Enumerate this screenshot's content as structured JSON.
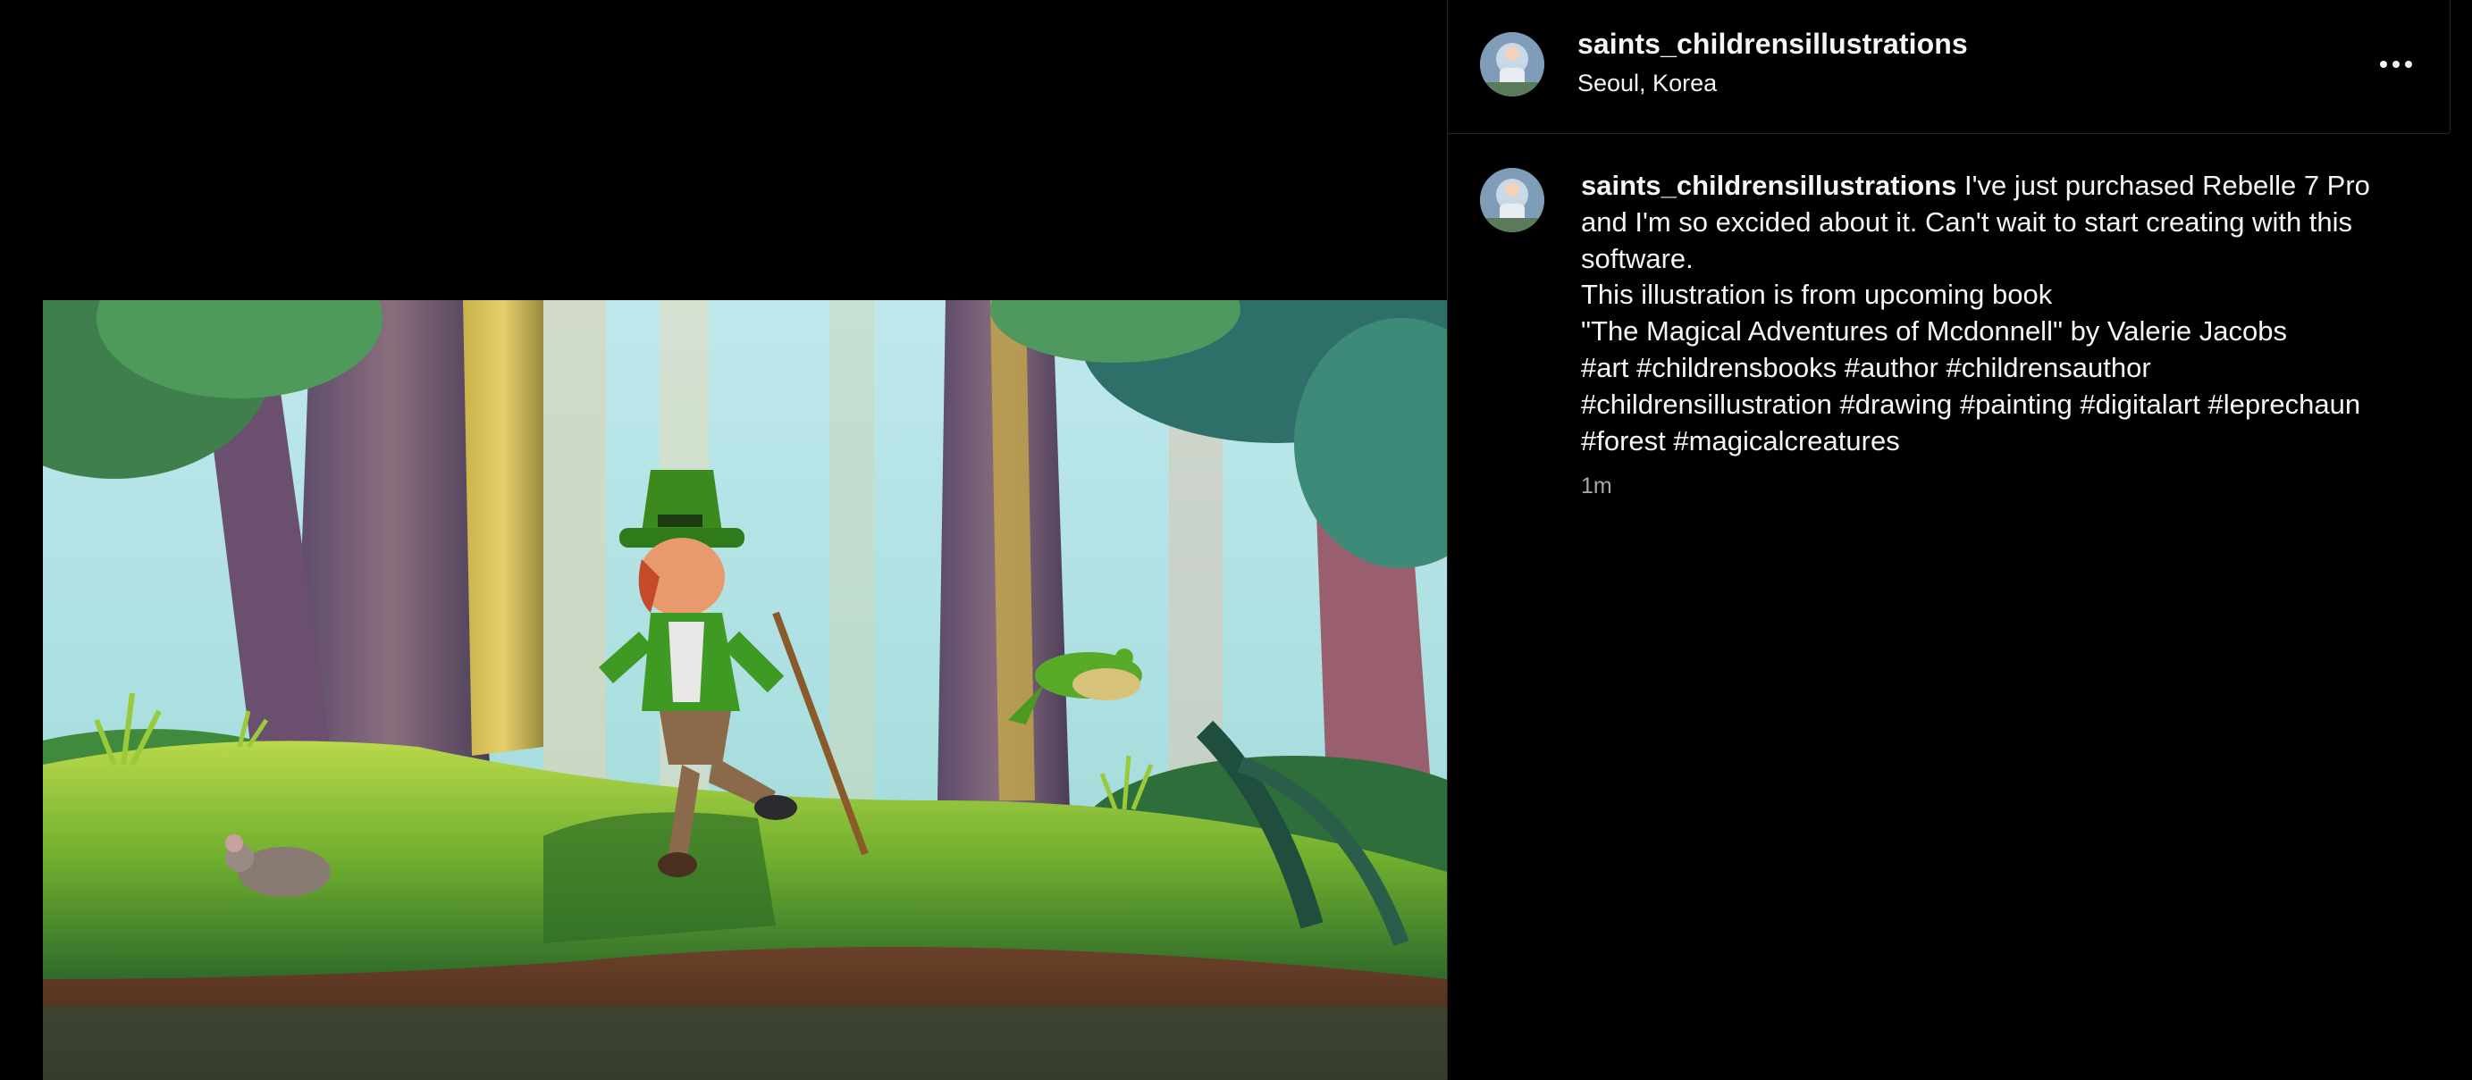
{
  "post": {
    "username": "saints_childrensillustrations",
    "location": "Seoul, Korea",
    "more_label": "More options",
    "image_alt": "Illustration of a leprechaun walking on a mossy log in a forest with a frog and mice"
  },
  "caption": {
    "username": "saints_childrensillustrations",
    "first_line_text": " I've just purchased Rebelle 7 Pro",
    "lines": [
      "and I'm so excided about it. Can't wait to start creating with this",
      "software.",
      "This illustration is from upcoming book",
      "\"The Magical Adventures of Mcdonnell\" by Valerie Jacobs"
    ],
    "hashtag_lines": [
      [
        "#art",
        "#childrensbooks",
        "#author",
        "#childrensauthor"
      ],
      [
        "#childrensillustration",
        "#drawing",
        "#painting",
        "#digitalart",
        "#leprechaun"
      ],
      [
        "#forest",
        "#magicalcreatures"
      ]
    ],
    "timestamp": "1m"
  },
  "colors": {
    "background": "#000000",
    "text": "#f5f5f5",
    "muted": "#a8a8a8",
    "divider": "#262626"
  }
}
